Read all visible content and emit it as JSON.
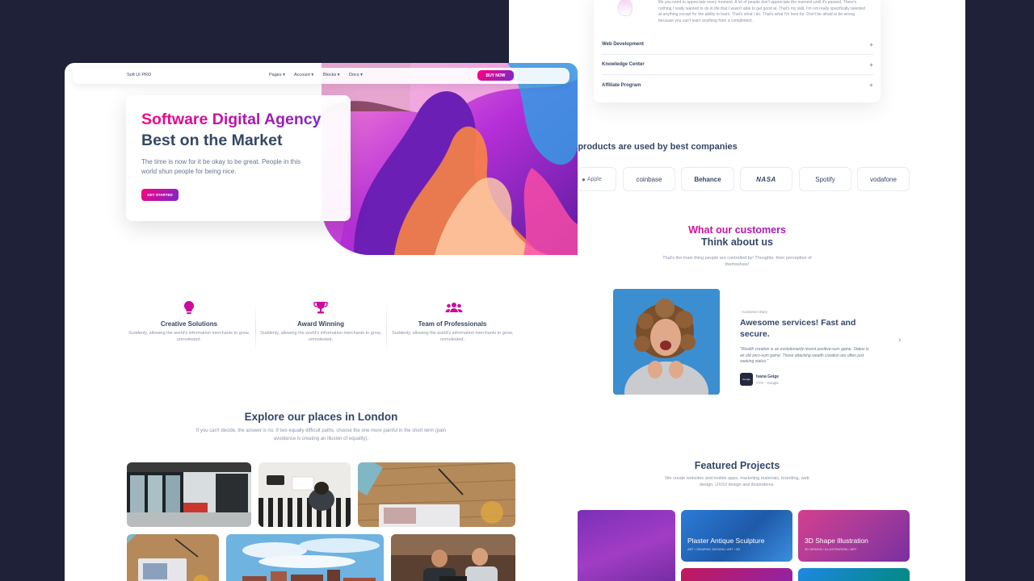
{
  "back": {
    "faq_text": "life you need to appreciate every moment. A lot of people don't appreciate the moment until it's passed. There's nothing I really wanted to do in life that I wasn't able to get good at. That's my skill. I'm not really specifically talented at anything except for the ability to learn. That's what I do. That's what I'm here for. Don't be afraid to be wrong because you can't learn anything from a compliment.",
    "faq_rows": [
      "Web Development",
      "Knowledge Center",
      "Affiliate Program"
    ],
    "faq_plus": "+",
    "companies_title": "r products are used by best companies",
    "logos": [
      "Apple",
      "coinbase",
      "Behance",
      "NASA",
      "Spotify",
      "vodafone"
    ],
    "customers": {
      "title_line1": "What our customers",
      "title_line2": "Think about us",
      "subtitle": "That's the main thing people are controlled by! Thoughts- their perception of themselves!"
    },
    "story": {
      "label": "- Customer Story",
      "title": "Awesome services! Fast and secure.",
      "quote": "\"Wealth creation is an evolutionarily recent positive-sum game. Status is an old zero-sum game. Those attacking wealth creation are often just seeking status.\"",
      "author": "Ivana Geige",
      "role": "CTO - Google",
      "avatar_text": "Google",
      "next_icon": "›"
    },
    "projects": {
      "title": "Featured Projects",
      "subtitle": "We create websites and mobile apps, marketing materials, branding, web design, UX/UI design and illustrations.",
      "cards": [
        {
          "title": "Plaster Antique Sculpture",
          "tags": "ART / GRAPHIC DESIGN / ART / 3D"
        },
        {
          "title": "3D Shape Illustration",
          "tags": "3D DESIGN / ILLUSTRATION / ART"
        }
      ]
    }
  },
  "front": {
    "nav": {
      "brand": "Soft UI PRO",
      "links": [
        "Pages",
        "Account",
        "Blocks",
        "Docs"
      ],
      "caret": "▾",
      "buy": "BUY NOW"
    },
    "hero": {
      "title_gradient": "Software Digital Agency",
      "title_dark": "Best on the Market",
      "text": "The time is now for it be okay to be great. People in this world shun people for being nice.",
      "cta": "GET STARTED"
    },
    "features": [
      {
        "icon": "lightbulb-icon",
        "glyph": "💡",
        "title": "Creative Solutions",
        "desc": "Suddenly, allowing the world's information merchants to grow, unmolested."
      },
      {
        "icon": "trophy-icon",
        "glyph": "🏆",
        "title": "Award Winning",
        "desc": "Suddenly, allowing the world's information merchants to grow, unmolested."
      },
      {
        "icon": "users-icon",
        "glyph": "👥",
        "title": "Team of Professionals",
        "desc": "Suddenly, allowing the world's information merchants to grow, unmolested."
      }
    ],
    "explore": {
      "title": "Explore our places in London",
      "subtitle": "If you can't decide, the answer is no. If two equally difficult paths, choose the one more painful in the short term (pain avoidance is creating an illusion of equality)."
    }
  },
  "colors": {
    "accent_start": "#7928ca",
    "accent_end": "#ff0080",
    "text_dark": "#344767",
    "background": "#1e2138"
  }
}
